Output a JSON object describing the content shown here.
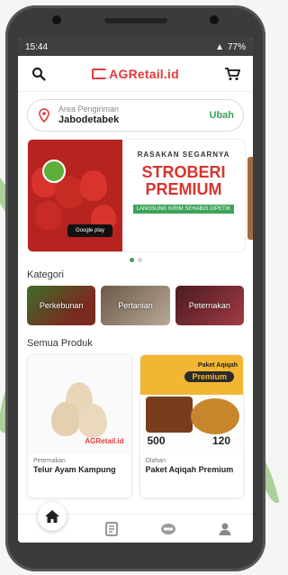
{
  "status_bar": {
    "time": "15:44",
    "battery": "77%"
  },
  "header": {
    "brand": "AGRetail.id"
  },
  "delivery": {
    "label": "Area Pengiriman",
    "value": "Jabodetabek",
    "action": "Ubah"
  },
  "banner": {
    "line1": "RASAKAN SEGARNYA",
    "line2": "STROBERI",
    "line3": "PREMIUM",
    "line4": "LANGSUNG KIRIM SEHABIS DIPETIK",
    "play_badge": "Google play"
  },
  "categories": {
    "title": "Kategori",
    "items": [
      "Perkebunan",
      "Pertanian",
      "Peternakan"
    ]
  },
  "products": {
    "title": "Semua Produk",
    "items": [
      {
        "category": "Peternakan",
        "name": "Telur Ayam Kampung",
        "watermark": "AGRetail.id"
      },
      {
        "category": "Olahan",
        "name": "Paket Aqiqah Premium",
        "img_title": "Paket Aqiqah",
        "img_badge": "Premium",
        "count_a": "500",
        "count_b": "120"
      }
    ]
  },
  "colors": {
    "accent": "#3ba35a",
    "brand": "#e23b3b"
  }
}
